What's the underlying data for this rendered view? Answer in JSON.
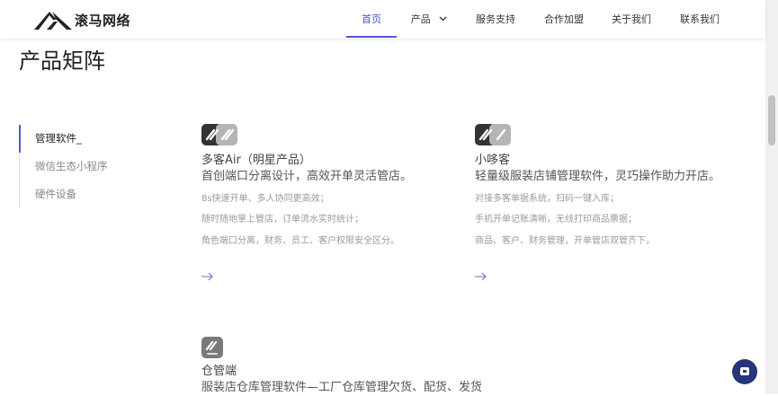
{
  "brand": {
    "name": "滚马网络"
  },
  "nav": {
    "items": [
      {
        "label": "首页",
        "active": true
      },
      {
        "label": "产品",
        "has_dropdown": true
      },
      {
        "label": "服务支持"
      },
      {
        "label": "合作加盟"
      },
      {
        "label": "关于我们"
      },
      {
        "label": "联系我们"
      }
    ]
  },
  "page": {
    "title": "产品矩阵"
  },
  "sidebar": {
    "items": [
      {
        "label": "管理软件_",
        "active": true
      },
      {
        "label": "微信生态小程序"
      },
      {
        "label": "硬件设备"
      }
    ]
  },
  "products": [
    {
      "name": "多客Air（明星产品）",
      "description": "首创端口分离设计，高效开单灵活管店。",
      "features": [
        "8s快速开单、多人协同更高效；",
        "随时随地掌上管店，订单流水实时统计；",
        "角色端口分离，财务、员工、客户权限安全区分。"
      ],
      "icon": "duoke-air-logo-icon"
    },
    {
      "name": "小哆客",
      "description": "轻量级服装店铺管理软件，灵巧操作助力开店。",
      "features": [
        "对接多客单据系统，扫码一键入库；",
        "手机开单记账清晰，无线打印商品票据；",
        "商品、客户、财务管理，开单管店双管齐下。"
      ],
      "icon": "xiaoduoke-logo-icon"
    },
    {
      "name": "仓管端",
      "description": "服装店仓库管理软件—工厂仓库管理欠货、配货、发货",
      "features": [],
      "icon": "cangguan-logo-icon"
    }
  ],
  "colors": {
    "accent": "#5558d9",
    "chat": "#26357a"
  }
}
